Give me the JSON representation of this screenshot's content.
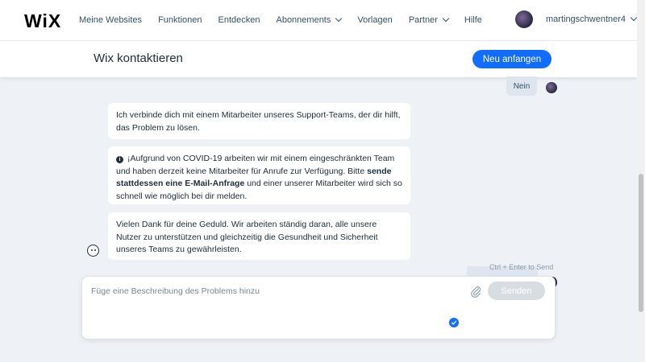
{
  "nav": {
    "logo": "WiX",
    "items": [
      {
        "label": "Meine Websites",
        "has_dropdown": false
      },
      {
        "label": "Funktionen",
        "has_dropdown": false
      },
      {
        "label": "Entdecken",
        "has_dropdown": false
      },
      {
        "label": "Abonnements",
        "has_dropdown": true
      },
      {
        "label": "Vorlagen",
        "has_dropdown": false
      },
      {
        "label": "Partner",
        "has_dropdown": true
      },
      {
        "label": "Hilfe",
        "has_dropdown": false
      }
    ],
    "username": "martingschwentner4"
  },
  "subbar": {
    "title": "Wix kontaktieren",
    "new_button": "Neu anfangen"
  },
  "chat": {
    "user_reply": "Nein",
    "messages": [
      {
        "text": "Ich verbinde dich mit einem Mitarbeiter unseres Support-Teams, der dir hilft, das Problem zu lösen."
      },
      {
        "text_before": "¡Aufgrund von COVID-19 arbeiten wir mit einem eingeschränkten Team und haben derzeit keine Mitarbeiter für Anrufe zur Verfügung. Bitte ",
        "link": "sende stattdessen eine E-Mail-Anfrage",
        "text_after": " und einer unserer Mitarbeiter wird sich so schnell wie möglich bei dir melden."
      },
      {
        "text": "Vielen Dank für deine Geduld. Wir arbeiten ständig daran, alle unsere Nutzer zu unterstützen und gleichzeitig die Gesundheit und Sicherheit unseres Teams zu gewährleisten."
      }
    ],
    "hint": "Ctrl + Enter to Send"
  },
  "composer": {
    "placeholder": "Füge eine Beschreibung des Problems hinzu",
    "value": "",
    "send_label": "Senden"
  },
  "colors": {
    "accent": "#116dff",
    "background": "#eef1f6",
    "text": "#20303c",
    "send_disabled": "#d8dde2"
  }
}
